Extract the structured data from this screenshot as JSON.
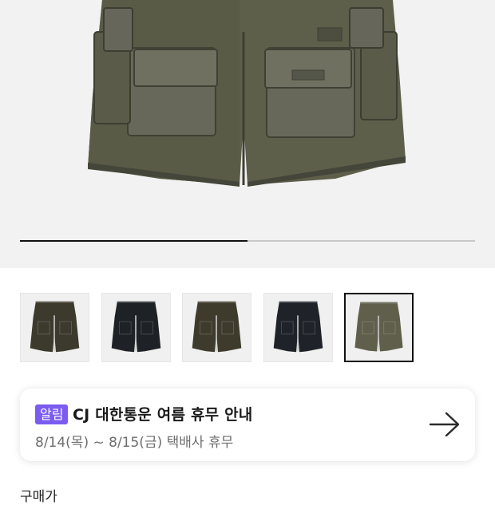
{
  "gallery": {
    "image": "olive-cargo-shorts",
    "progress": 0.5,
    "thumbnails": [
      {
        "item": "dark-olive-cargo-shorts",
        "color": "#3c3a2c",
        "selected": false
      },
      {
        "item": "black-cargo-shorts",
        "color": "#1e2226",
        "selected": false
      },
      {
        "item": "dark-olive-cargo-shorts",
        "color": "#3e3b2d",
        "selected": false
      },
      {
        "item": "black-cargo-shorts",
        "color": "#1f2329",
        "selected": false
      },
      {
        "item": "olive-cargo-shorts",
        "color": "#5f5f4b",
        "selected": true
      }
    ]
  },
  "notice": {
    "badge": "알림",
    "title": "CJ 대한통운 여름 휴무 안내",
    "subtitle": "8/14(목) ~ 8/15(금) 택배사 휴무",
    "icon": "arrow-right-icon",
    "badge_color": "#7a5cf0"
  },
  "next_section": {
    "label": "구매가"
  }
}
